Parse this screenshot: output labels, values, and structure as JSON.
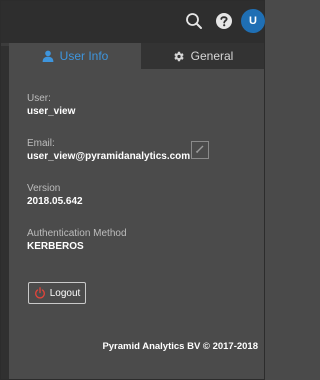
{
  "header": {
    "avatar_initial": "U"
  },
  "tabs": [
    {
      "label": "User Info",
      "icon": "user-icon",
      "active": true
    },
    {
      "label": "General",
      "icon": "gear-icon",
      "active": false
    }
  ],
  "user_info": {
    "user_label": "User:",
    "user_value": "user_view",
    "email_label": "Email:",
    "email_value": "user_view@pyramidanalytics.com",
    "version_label": "Version",
    "version_value": "2018.05.642",
    "auth_label": "Authentication Method",
    "auth_value": "KERBEROS"
  },
  "logout_label": "Logout",
  "footer_text": "Pyramid Analytics BV © 2017-2018",
  "colors": {
    "accent": "#3e95dd",
    "avatar": "#1f6fb4",
    "logout_icon": "#e0443a"
  }
}
